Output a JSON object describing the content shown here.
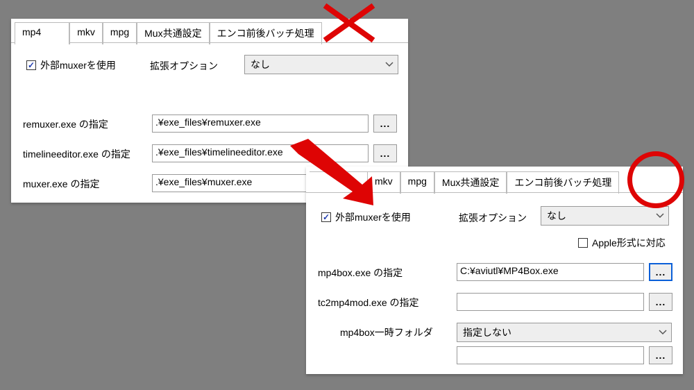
{
  "common": {
    "browse_label": "...",
    "ext_opt_label": "拡張オプション",
    "ext_opt_value": "なし",
    "use_external_muxer": "外部muxerを使用"
  },
  "shotA": {
    "tabs": [
      "mp4",
      "mkv",
      "mpg",
      "Mux共通設定",
      "エンコ前後バッチ処理"
    ],
    "active_tab": 0,
    "field1_label": "remuxer.exe の指定",
    "field1_value": ".¥exe_files¥remuxer.exe",
    "field2_label": "timelineeditor.exe の指定",
    "field2_value": ".¥exe_files¥timelineeditor.exe",
    "field3_label": "muxer.exe の指定",
    "field3_value": ".¥exe_files¥muxer.exe"
  },
  "shotB": {
    "tabs": [
      "mkv",
      "mpg",
      "Mux共通設定",
      "エンコ前後バッチ処理"
    ],
    "apple_label": "Apple形式に対応",
    "field1_label": "mp4box.exe の指定",
    "field1_value": "C:¥aviutl¥MP4Box.exe",
    "field2_label": "tc2mp4mod.exe の指定",
    "field2_value": "",
    "field3_label": "mp4box一時フォルダ",
    "field3_select": "指定しない",
    "field3_text": ""
  }
}
